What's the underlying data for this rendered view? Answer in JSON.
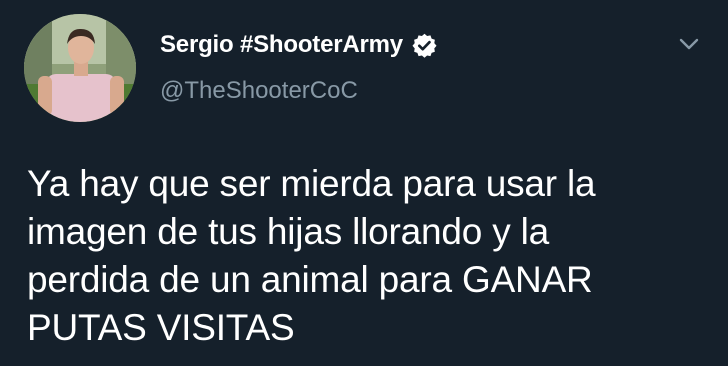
{
  "author": {
    "display_name": "Sergio #ShooterArmy",
    "handle": "@TheShooterCoC",
    "verified": true
  },
  "icons": {
    "verified": "verified-badge-icon",
    "more": "chevron-down-icon"
  },
  "tweet": {
    "lines": [
      "Ya hay que ser mierda para usar la",
      "imagen de tus hijas llorando y la",
      "perdida de un animal para GANAR",
      "PUTAS VISITAS"
    ]
  },
  "colors": {
    "background": "#15202b",
    "text": "#ffffff",
    "secondary_text": "#8899a6",
    "icon": "#8899a6"
  }
}
